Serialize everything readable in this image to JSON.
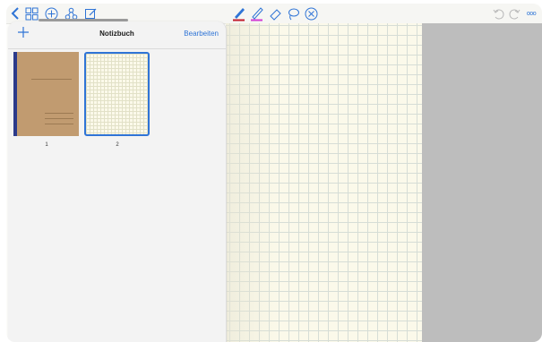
{
  "toolbar": {
    "left_icons": [
      "back-chevron-icon",
      "grid-view-icon",
      "add-circle-icon",
      "share-icon",
      "edit-note-icon"
    ],
    "tools": [
      "pen-tool-icon",
      "highlighter-tool-icon",
      "eraser-tool-icon",
      "lasso-tool-icon",
      "close-circle-icon"
    ],
    "right_icons": [
      "undo-icon",
      "redo-icon",
      "more-icon"
    ],
    "more_label": "ooo",
    "colors": {
      "pen": "#c11b2a",
      "highlighter": "#d23bd3",
      "accent": "#2f74d6"
    }
  },
  "panel": {
    "title": "Notizbuch",
    "edit_label": "Bearbeiten",
    "add_label": "+",
    "pages": [
      {
        "number": "1",
        "type": "cover"
      },
      {
        "number": "2",
        "type": "grid",
        "selected": true
      }
    ]
  }
}
